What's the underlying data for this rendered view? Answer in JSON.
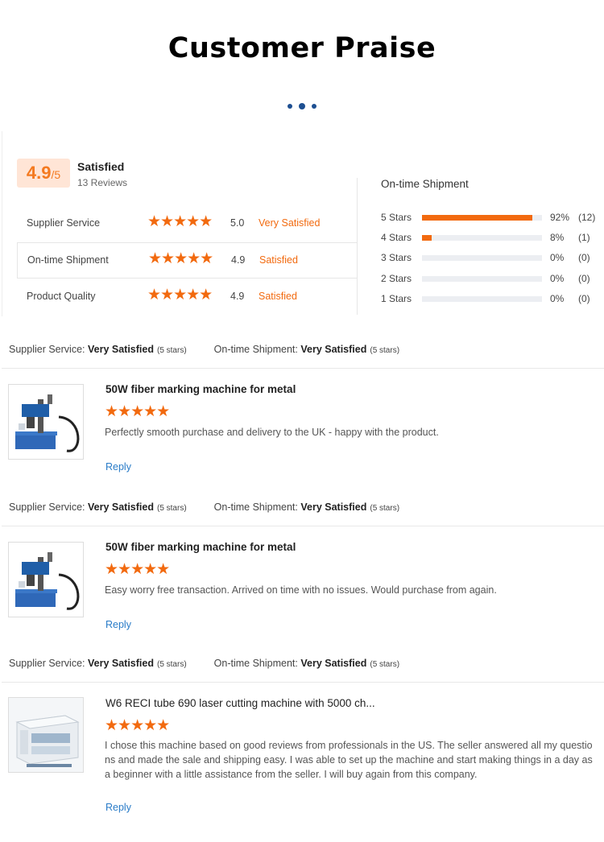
{
  "header": {
    "title": "Customer Praise"
  },
  "summary": {
    "score": "4.9",
    "score_max": "/5",
    "overall": "Satisfied",
    "review_count": "13 Reviews",
    "ratings": [
      {
        "label": "Supplier Service",
        "stars": "★★★★★",
        "value": "5.0",
        "verdict": "Very Satisfied"
      },
      {
        "label": "On-time Shipment",
        "stars": "★★★★★",
        "value": "4.9",
        "verdict": "Satisfied"
      },
      {
        "label": "Product Quality",
        "stars": "★★★★★",
        "value": "4.9",
        "verdict": "Satisfied"
      }
    ],
    "distribution_title": "On-time Shipment",
    "distribution": [
      {
        "label": "5 Stars",
        "percent": 92,
        "percent_text": "92%",
        "count": "(12)"
      },
      {
        "label": "4 Stars",
        "percent": 8,
        "percent_text": "8%",
        "count": "(1)"
      },
      {
        "label": "3 Stars",
        "percent": 0,
        "percent_text": "0%",
        "count": "(0)"
      },
      {
        "label": "2 Stars",
        "percent": 0,
        "percent_text": "0%",
        "count": "(0)"
      },
      {
        "label": "1 Stars",
        "percent": 0,
        "percent_text": "0%",
        "count": "(0)"
      }
    ]
  },
  "reviews": [
    {
      "supplier_label": "Supplier Service:",
      "supplier_verdict": "Very Satisfied",
      "supplier_stars": "(5 stars)",
      "shipment_label": "On-time Shipment:",
      "shipment_verdict": "Very Satisfied",
      "shipment_stars": "(5 stars)",
      "product": "50W fiber marking machine for metal",
      "stars": "★★★★★",
      "text": "Perfectly smooth purchase and delivery to the UK - happy with the product.",
      "reply": "Reply"
    },
    {
      "supplier_label": "Supplier Service:",
      "supplier_verdict": "Very Satisfied",
      "supplier_stars": "(5 stars)",
      "shipment_label": "On-time Shipment:",
      "shipment_verdict": "Very Satisfied",
      "shipment_stars": "(5 stars)",
      "product": "50W fiber marking machine for metal",
      "stars": "★★★★★",
      "text": "Easy worry free transaction. Arrived on time with no issues. Would purchase from again.",
      "reply": "Reply"
    },
    {
      "supplier_label": "Supplier Service:",
      "supplier_verdict": "Very Satisfied",
      "supplier_stars": "(5 stars)",
      "shipment_label": "On-time Shipment:",
      "shipment_verdict": "Very Satisfied",
      "shipment_stars": "(5 stars)",
      "product": "W6 RECI tube 690 laser cutting machine with 5000 ch...",
      "stars": "★★★★★",
      "text": "I chose this machine based on good reviews from professionals in the US.  The seller answered all my questions and made the sale and shipping easy.  I was able to set up the machine and start making things in a day as a beginner with a little assistance from the seller.  I will buy again from this company.",
      "reply": "Reply"
    }
  ],
  "colors": {
    "accent": "#f26a0f",
    "link": "#2a7cc8",
    "dots": "#1d4f91",
    "badge_bg": "#ffe5d6"
  }
}
